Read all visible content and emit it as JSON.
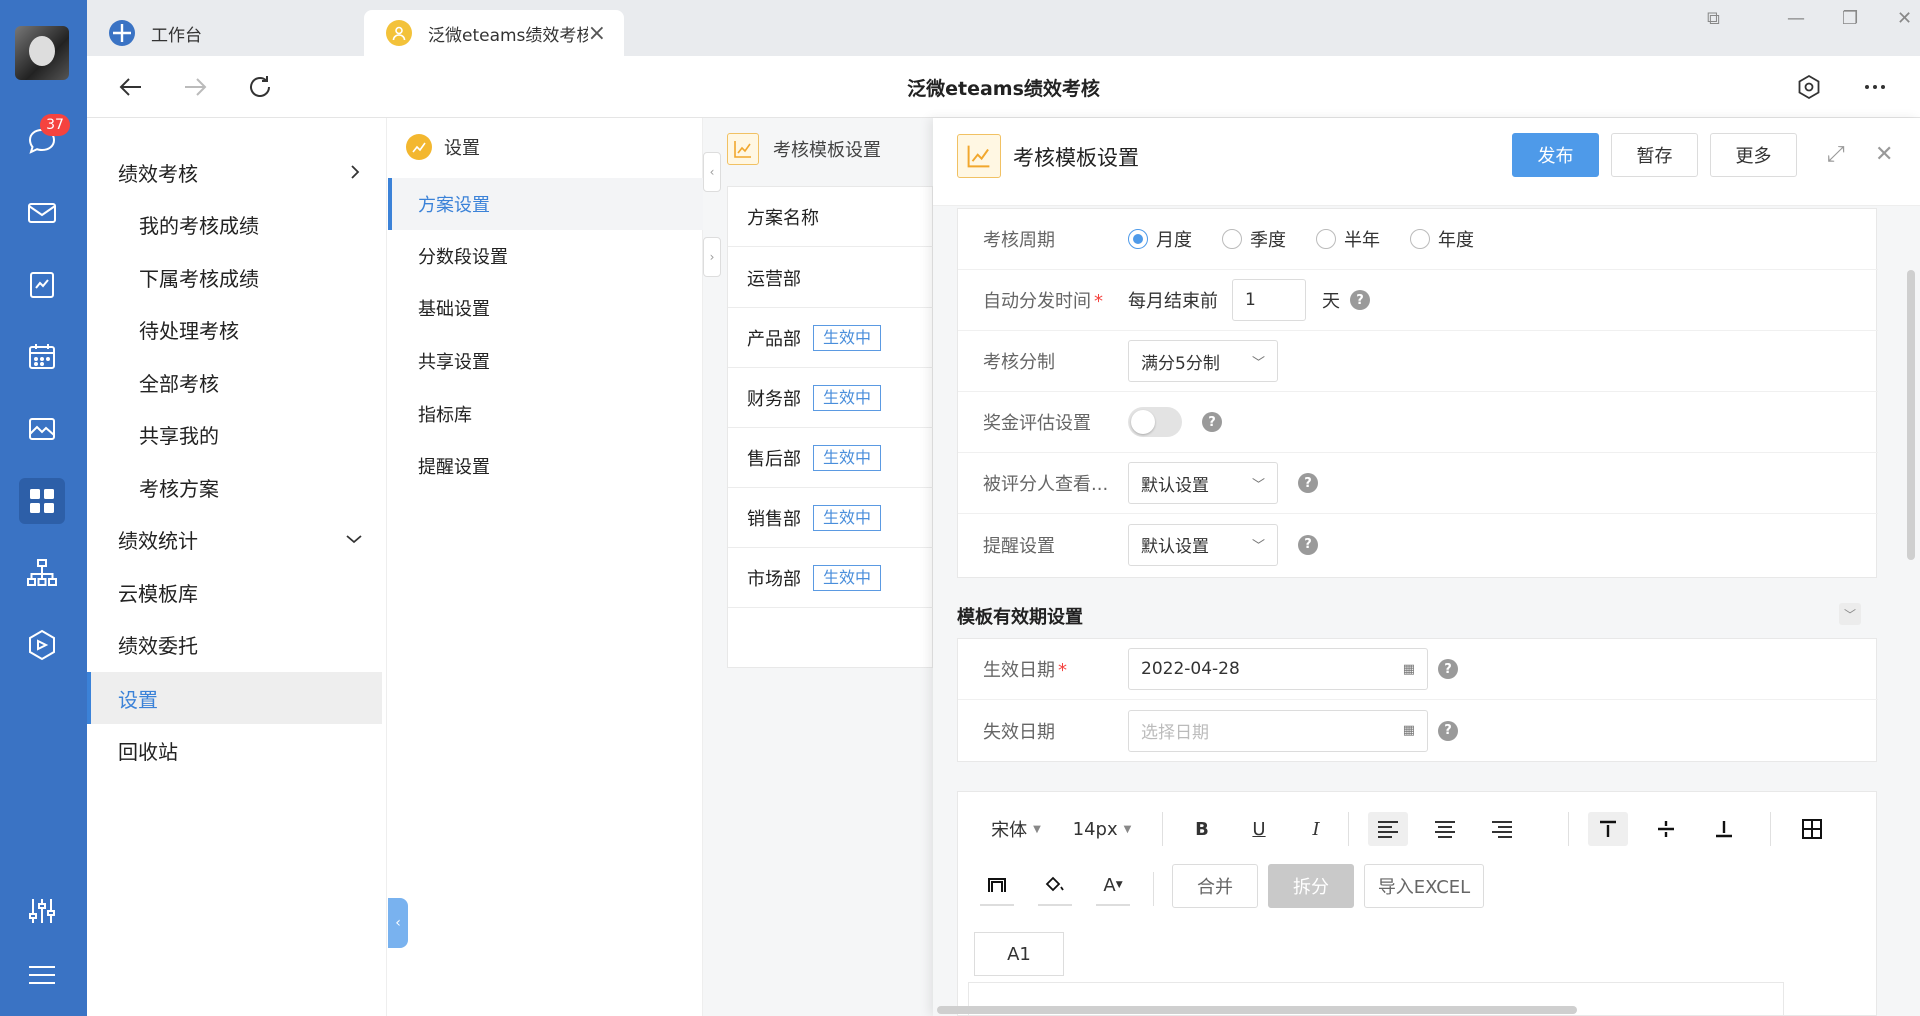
{
  "rail": {
    "badge_count": "37",
    "icons": [
      "chat-icon",
      "mail-icon",
      "todo-icon",
      "calendar-icon",
      "photo-icon",
      "apps-icon",
      "org-icon",
      "cube-icon",
      "sliders-icon",
      "menu-icon"
    ]
  },
  "tabs": [
    {
      "label": "工作台"
    },
    {
      "label": "泛微eteams绩效考核"
    }
  ],
  "nav": {
    "title": "泛微eteams绩效考核"
  },
  "module_nav": {
    "items": [
      {
        "label": "绩效考核",
        "level": 1,
        "chevron": "›"
      },
      {
        "label": "我的考核成绩",
        "level": 2
      },
      {
        "label": "下属考核成绩",
        "level": 2
      },
      {
        "label": "待处理考核",
        "level": 2
      },
      {
        "label": "全部考核",
        "level": 2
      },
      {
        "label": "共享我的",
        "level": 2
      },
      {
        "label": "考核方案",
        "level": 2
      },
      {
        "label": "绩效统计",
        "level": 1,
        "chevron": "⌄"
      },
      {
        "label": "云模板库",
        "level": 1
      },
      {
        "label": "绩效委托",
        "level": 1
      },
      {
        "label": "设置",
        "level": 1,
        "active": true
      },
      {
        "label": "回收站",
        "level": 1
      }
    ]
  },
  "settings_nav": {
    "header": "设置",
    "items": [
      {
        "label": "方案设置",
        "active": true
      },
      {
        "label": "分数段设置"
      },
      {
        "label": "基础设置"
      },
      {
        "label": "共享设置"
      },
      {
        "label": "指标库"
      },
      {
        "label": "提醒设置"
      }
    ]
  },
  "plan_list": {
    "header": "考核模板设置",
    "column": "方案名称",
    "rows": [
      {
        "name": "运营部",
        "status": ""
      },
      {
        "name": "产品部",
        "status": "生效中"
      },
      {
        "name": "财务部",
        "status": "生效中"
      },
      {
        "name": "售后部",
        "status": "生效中"
      },
      {
        "name": "销售部",
        "status": "生效中"
      },
      {
        "name": "市场部",
        "status": "生效中"
      }
    ]
  },
  "detail": {
    "title": "考核模板设置",
    "publish_label": "发布",
    "save_label": "暂存",
    "more_label": "更多",
    "cycle": {
      "label": "考核周期",
      "options": [
        "月度",
        "季度",
        "半年",
        "年度"
      ],
      "selected": "月度"
    },
    "auto_dispatch": {
      "label": "自动分发时间",
      "prefix": "每月结束前",
      "value": "1",
      "unit": "天"
    },
    "score_system": {
      "label": "考核分制",
      "value": "满分5分制"
    },
    "bonus": {
      "label": "奖金评估设置",
      "enabled": false
    },
    "reviewee_view": {
      "label": "被评分人查看...",
      "value": "默认设置"
    },
    "reminder": {
      "label": "提醒设置",
      "value": "默认设置"
    },
    "validity_section": "模板有效期设置",
    "effective_date": {
      "label": "生效日期",
      "value": "2022-04-28"
    },
    "expire_date": {
      "label": "失效日期",
      "placeholder": "选择日期"
    },
    "editor": {
      "font": "宋体",
      "size": "14px",
      "merge_label": "合并",
      "split_label": "拆分",
      "import_label": "导入EXCEL",
      "cell_ref": "A1"
    }
  }
}
